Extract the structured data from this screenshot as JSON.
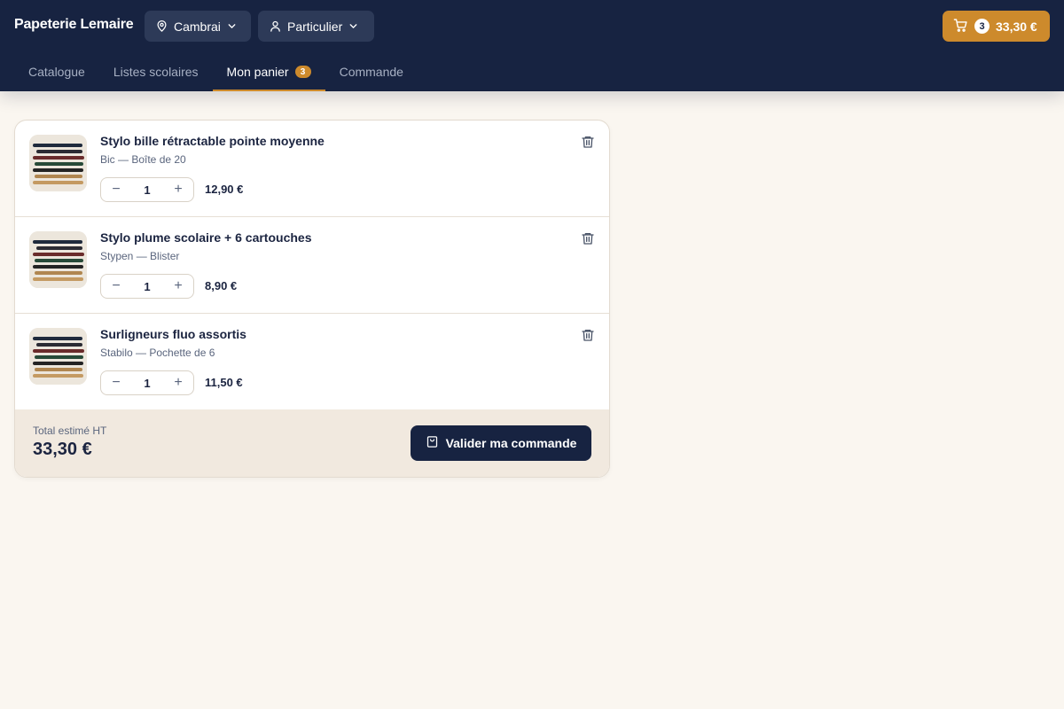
{
  "header": {
    "brand": "Papeterie Lemaire",
    "location": {
      "label": "Cambrai",
      "icon": "map-pin-icon"
    },
    "customer_type": {
      "label": "Particulier",
      "icon": "user-icon"
    },
    "cart": {
      "count": "3",
      "total": "33,30 €",
      "icon": "cart-icon"
    }
  },
  "nav": {
    "tabs": [
      {
        "label": "Catalogue",
        "active": false
      },
      {
        "label": "Listes scolaires",
        "active": false
      },
      {
        "label": "Mon panier",
        "badge": "3",
        "active": true
      },
      {
        "label": "Commande",
        "active": false
      }
    ]
  },
  "cart": {
    "items": [
      {
        "title": "Stylo bille rétractable pointe moyenne",
        "subtitle": "Bic — Boîte de 20",
        "quantity": "1",
        "price": "12,90 €"
      },
      {
        "title": "Stylo plume scolaire + 6 cartouches",
        "subtitle": "Stypen — Blister",
        "quantity": "1",
        "price": "8,90 €"
      },
      {
        "title": "Surligneurs fluo assortis",
        "subtitle": "Stabilo — Pochette de 6",
        "quantity": "1",
        "price": "11,50 €"
      }
    ],
    "decrement_symbol": "−",
    "increment_symbol": "+",
    "total_label": "Total estimé HT",
    "total_value": "33,30 €",
    "checkout_label": "Valider ma commande"
  },
  "colors": {
    "navy": "#172341",
    "accent": "#cd8a2c",
    "page_bg": "#faf6f0",
    "footer_bg": "#f1e9df"
  }
}
